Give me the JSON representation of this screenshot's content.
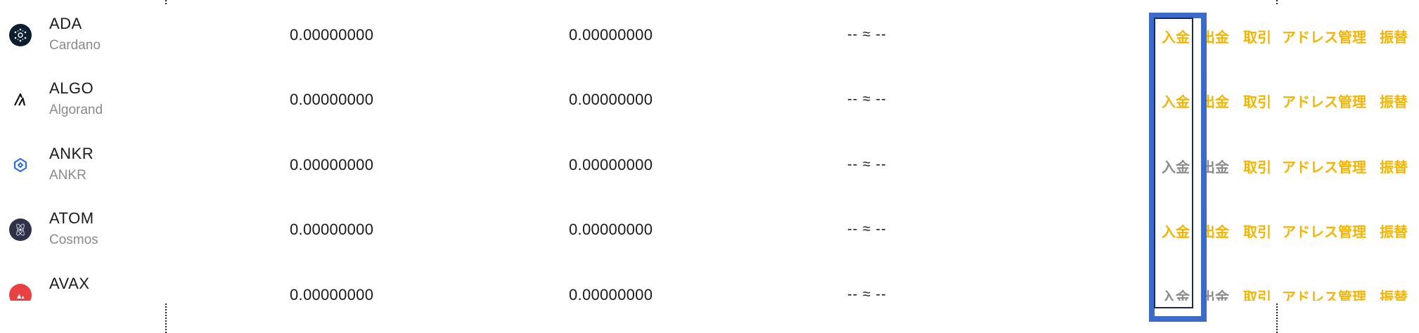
{
  "actions": {
    "deposit": "入金",
    "withdraw": "出金",
    "trade": "取引",
    "address": "アドレス管理",
    "transfer": "振替"
  },
  "colors": {
    "action_enabled": "#f4b400",
    "action_disabled": "#8c8c8c",
    "highlight": "#3b6ac8"
  },
  "assets": [
    {
      "symbol": "ADA",
      "name": "Cardano",
      "available": "0.00000000",
      "total": "0.00000000",
      "fiat": "-- ≈ --",
      "icon": "cardano-icon",
      "deposit_enabled": true,
      "withdraw_enabled": true
    },
    {
      "symbol": "ALGO",
      "name": "Algorand",
      "available": "0.00000000",
      "total": "0.00000000",
      "fiat": "-- ≈ --",
      "icon": "algorand-icon",
      "deposit_enabled": true,
      "withdraw_enabled": true
    },
    {
      "symbol": "ANKR",
      "name": "ANKR",
      "available": "0.00000000",
      "total": "0.00000000",
      "fiat": "-- ≈ --",
      "icon": "ankr-icon",
      "deposit_enabled": false,
      "withdraw_enabled": false
    },
    {
      "symbol": "ATOM",
      "name": "Cosmos",
      "available": "0.00000000",
      "total": "0.00000000",
      "fiat": "-- ≈ --",
      "icon": "cosmos-icon",
      "deposit_enabled": true,
      "withdraw_enabled": true
    },
    {
      "symbol": "AVAX",
      "name": "",
      "available": "0.00000000",
      "total": "0.00000000",
      "fiat": "-- ≈ --",
      "icon": "avalanche-icon",
      "deposit_enabled": false,
      "withdraw_enabled": false
    }
  ]
}
